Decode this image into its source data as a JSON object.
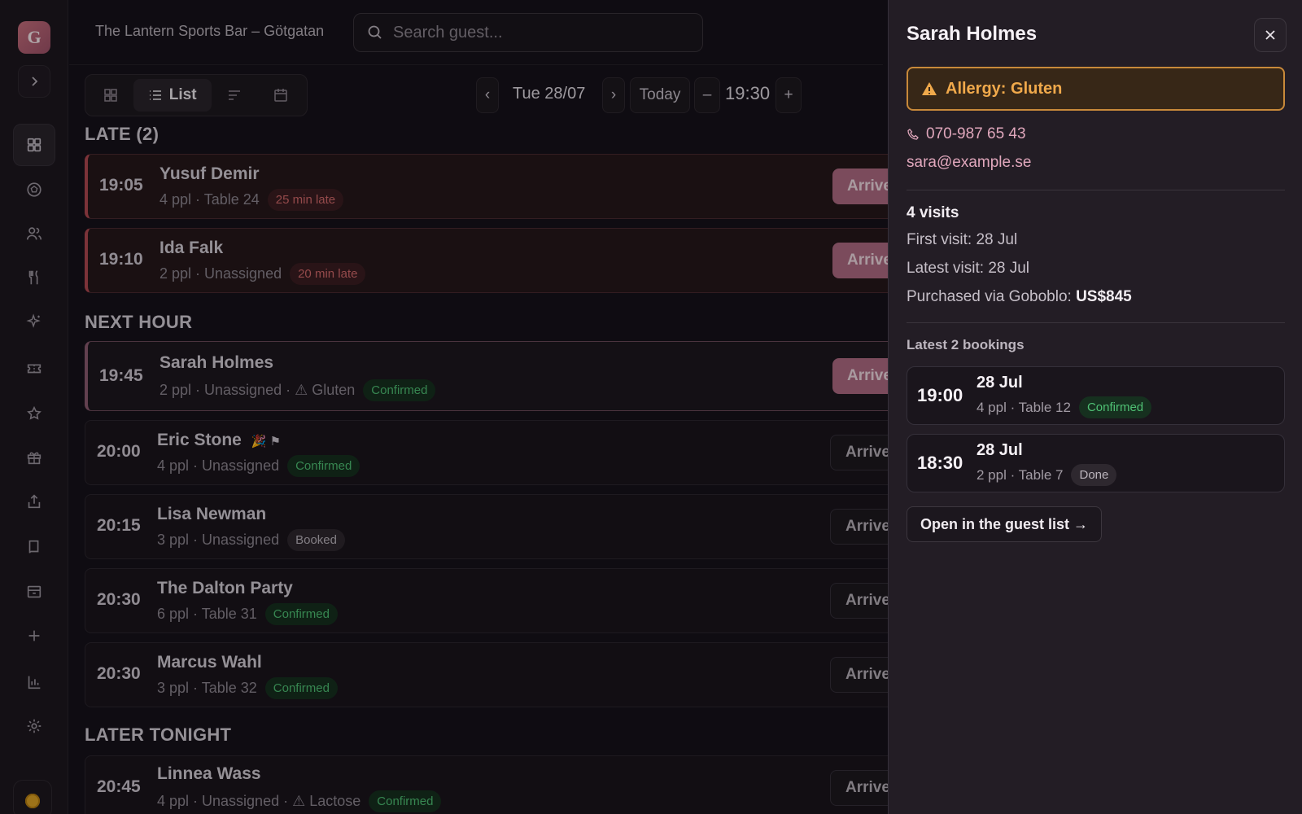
{
  "brand": {
    "letter": "G"
  },
  "header": {
    "venue": "The Lantern Sports Bar – Götgatan",
    "search_placeholder": "Search guest..."
  },
  "toolbar": {
    "view_list_label": "List",
    "date": "Tue 28/07",
    "prev": "‹",
    "next": "›",
    "today": "Today",
    "minus": "–",
    "time": "19:30",
    "plus": "+"
  },
  "sections": {
    "late": "LATE (2)",
    "next_hour": "NEXT HOUR",
    "later": "LATER TONIGHT"
  },
  "bookings": [
    {
      "time": "19:05",
      "name": "Yusuf Demir",
      "meta": "4 ppl · Table 24",
      "badge": "25 min late",
      "arrived": "Arrived"
    },
    {
      "time": "19:10",
      "name": "Ida Falk",
      "meta": "2 ppl · Unassigned",
      "badge": "20 min late",
      "arrived": "Arrived"
    },
    {
      "time": "19:45",
      "name": "Sarah Holmes",
      "meta": "2 ppl · Unassigned · ⚠ Gluten",
      "badge": "Confirmed",
      "arrived": "Arrived"
    },
    {
      "time": "20:00",
      "name": "Eric Stone",
      "meta": "4 ppl · Unassigned",
      "badge": "Confirmed",
      "arrived": "Arrived",
      "extra": "🎉 ⚑"
    },
    {
      "time": "20:15",
      "name": "Lisa Newman",
      "meta": "3 ppl · Unassigned",
      "badge": "Booked",
      "arrived": "Arrived"
    },
    {
      "time": "20:30",
      "name": "The Dalton Party",
      "meta": "6 ppl · Table 31",
      "badge": "Confirmed",
      "arrived": "Arrived"
    },
    {
      "time": "20:30",
      "name": "Marcus Wahl",
      "meta": "3 ppl · Table 32",
      "badge": "Confirmed",
      "arrived": "Arrived"
    },
    {
      "time": "20:45",
      "name": "Linnea Wass",
      "meta": "4 ppl · Unassigned · ⚠ Lactose",
      "badge": "Confirmed",
      "arrived": "Arrived"
    }
  ],
  "panel": {
    "name": "Sarah Holmes",
    "allergy": "Allergy: Gluten",
    "phone": "070-987 65 43",
    "email": "sara@example.se",
    "visits": "4 visits",
    "first_visit": "First visit: 28 Jul",
    "latest_visit": "Latest visit: 28 Jul",
    "purchased_prefix": "Purchased via Goboblo:",
    "purchased_amount": "US$845",
    "latest_bookings_title": "Latest 2 bookings",
    "history": [
      {
        "time": "19:00",
        "date": "28 Jul",
        "meta": "4 ppl · Table 12",
        "badge": "Confirmed"
      },
      {
        "time": "18:30",
        "date": "28 Jul",
        "meta": "2 ppl · Table 7",
        "badge": "Done"
      }
    ],
    "open_button": "Open in the guest list →"
  },
  "colors": {
    "accent": "#b06c85",
    "late": "#b24a52",
    "confirmed": "#4fc074",
    "allergy": "#f0a94b"
  }
}
